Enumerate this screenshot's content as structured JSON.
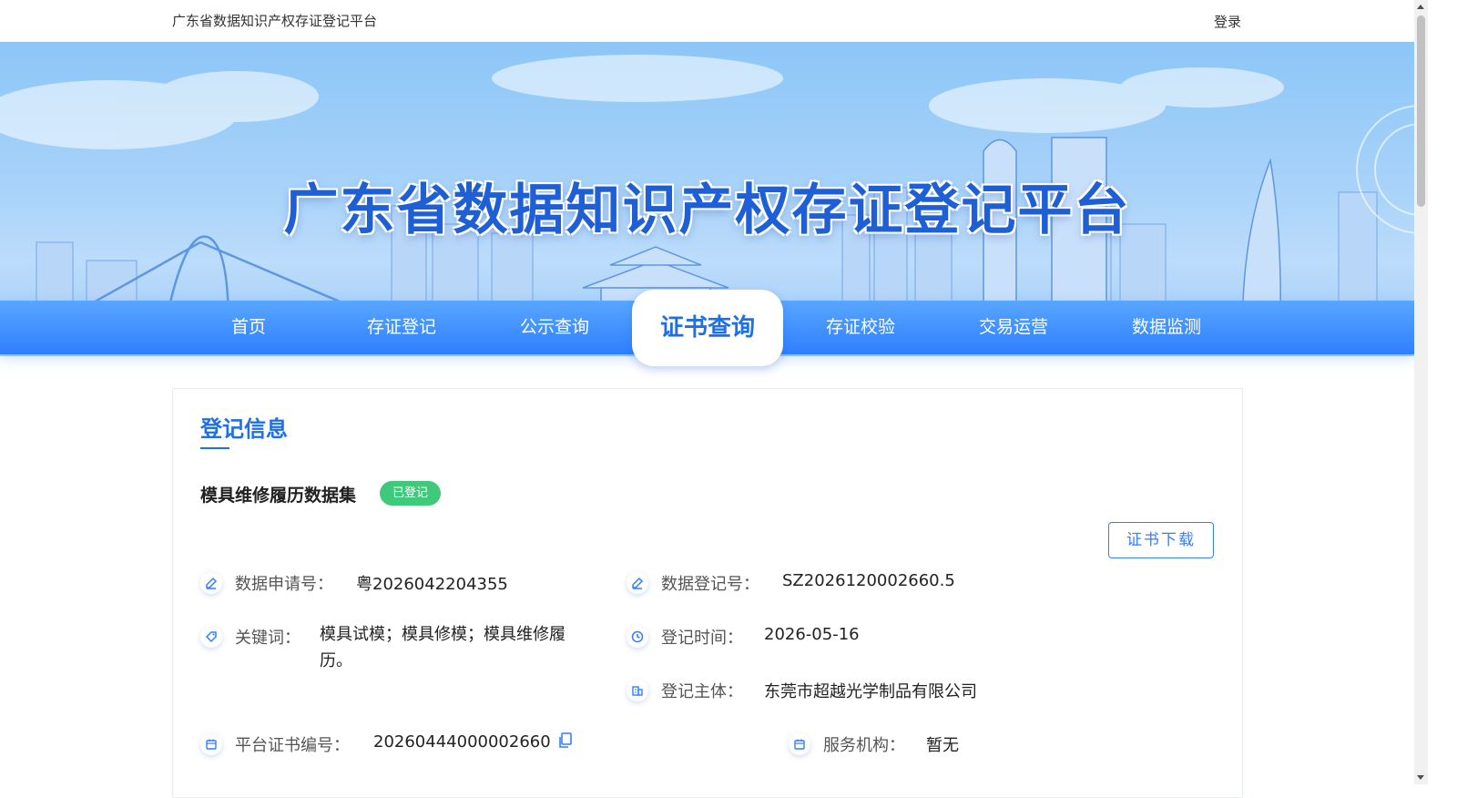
{
  "header": {
    "site_title": "广东省数据知识产权存证登记平台",
    "login_label": "登录"
  },
  "banner": {
    "title": "广东省数据知识产权存证登记平台"
  },
  "nav": {
    "items": [
      {
        "label": "首页",
        "active": false
      },
      {
        "label": "存证登记",
        "active": false
      },
      {
        "label": "公示查询",
        "active": false
      },
      {
        "label": "证书查询",
        "active": true
      },
      {
        "label": "存证校验",
        "active": false
      },
      {
        "label": "交易运营",
        "active": false
      },
      {
        "label": "数据监测",
        "active": false
      }
    ]
  },
  "registration": {
    "section_title": "登记信息",
    "dataset_name": "模具维修履历数据集",
    "status": "已登记",
    "download_label": "证书下载",
    "fields": {
      "application_no": {
        "label": "数据申请号：",
        "value": "粤2026042204355",
        "icon": "edit-icon"
      },
      "registration_no": {
        "label": "数据登记号：",
        "value": "SZ2026120002660.5",
        "icon": "edit-icon"
      },
      "keywords": {
        "label": "关键词：",
        "value": "模具试模；模具修模；模具维修履历。",
        "icon": "tag-icon"
      },
      "registration_time": {
        "label": "登记时间：",
        "value": "2026-05-16",
        "icon": "clock-icon"
      },
      "registrant": {
        "label": "登记主体：",
        "value": "东莞市超越光学制品有限公司",
        "icon": "building-icon"
      },
      "certificate_no": {
        "label": "平台证书编号：",
        "value": "20260444000002660",
        "icon": "calendar-icon"
      },
      "service_agency": {
        "label": "服务机构：",
        "value": "暂无",
        "icon": "calendar-icon"
      }
    }
  },
  "colors": {
    "primary": "#1f6fe5",
    "nav_gradient_top": "#58a6ff",
    "nav_gradient_bottom": "#2f7fff",
    "badge_green": "#3fc97a"
  }
}
